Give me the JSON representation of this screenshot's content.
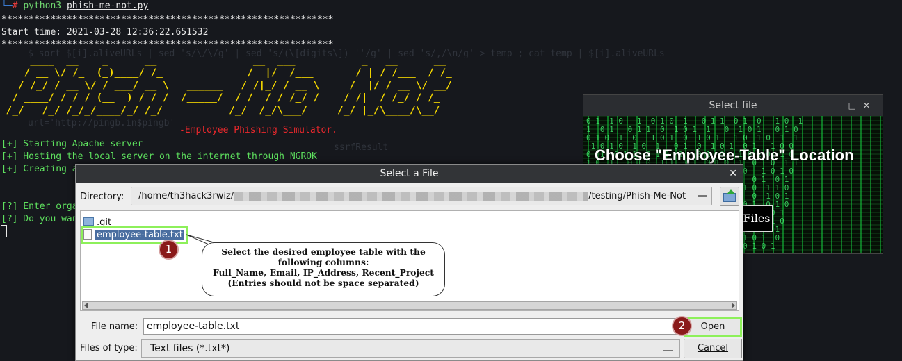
{
  "terminal": {
    "command": {
      "interpreter": "python3",
      "script": "phish-me-not.py"
    },
    "stars": "*************************************************************",
    "start_time": "Start time: 2021-03-28 12:36:22.651532",
    "ascii_banner": [
      "     ____  __    _      __                __  ___           _   __      __ ",
      "    / __ \\/ /_  (_)____/ /_              /  |/  /___       / | / /___  / /_",
      "   / /_/ / __ \\/ / ___/ __ \\   ______   / /|_/ / __ \\     /  |/ / __ \\/ __/",
      "  / ____/ / / / (__  ) / / /  /_____/  / /  / / /_/ /    / /|  / /_/ / /_  ",
      " /_/   /_/ /_/_/____/_/ /_/           /_/  /_/\\___/     /_/ |_/\\____/\\__/  "
    ],
    "subtitle": "-Employee Phishing Simulator.",
    "status": [
      "[+] Starting Apache server",
      "[+] Hosting the local server on the internet through NGROK",
      "[+] Creating a"
    ],
    "prompts": [
      "[?] Enter orga",
      "[?] Do you wan"
    ]
  },
  "background_window": {
    "title": "Select file",
    "heading": "Choose \"Employee-Table\" Location",
    "files_button": "Files"
  },
  "dialog": {
    "title": "Select a File",
    "directory_label": "Directory:",
    "directory_prefix": "/home/th3hack3rwiz/",
    "directory_suffix": "/testing/Phish-Me-Not",
    "files": [
      {
        "name": ".git",
        "type": "folder"
      },
      {
        "name": "employee-table.txt",
        "type": "file"
      }
    ],
    "file_name_label": "File name:",
    "file_name_value": "employee-table.txt",
    "files_of_type_label": "Files of type:",
    "files_of_type_value": "Text files (*.txt*)",
    "open_label": "Open",
    "cancel_label": "Cancel"
  },
  "annotations": {
    "step1": "1",
    "step2": "2",
    "callout_lines": [
      "Select the desired employee table with the",
      "following columns:",
      "Full_Name, Email, IP_Address, Recent_Project",
      "(Entries should not be space separated)"
    ],
    "highlight_color": "#8df05a",
    "badge_color": "#8a1a1a"
  }
}
